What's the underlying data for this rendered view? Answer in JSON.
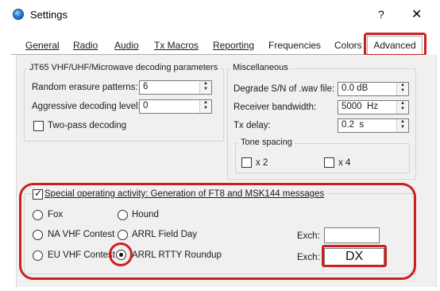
{
  "window": {
    "title": "Settings",
    "help": "?",
    "close": "✕"
  },
  "tabs": [
    {
      "label": "General"
    },
    {
      "label": "Radio"
    },
    {
      "label": "Audio"
    },
    {
      "label": "Tx Macros"
    },
    {
      "label": "Reporting"
    },
    {
      "label": "Frequencies"
    },
    {
      "label": "Colors"
    },
    {
      "label": "Advanced",
      "active": true
    }
  ],
  "jt65": {
    "title": "JT65 VHF/UHF/Microwave decoding parameters",
    "random_erasure_label": "Random erasure patterns:",
    "random_erasure_value": "6",
    "aggressive_label": "Aggressive decoding level:",
    "aggressive_value": "0",
    "two_pass_label": "Two-pass decoding",
    "two_pass_checked": false
  },
  "misc": {
    "title": "Miscellaneous",
    "degrade_label": "Degrade S/N of .wav file:",
    "degrade_value": "0.0 dB",
    "bandwidth_label": "Receiver bandwidth:",
    "bandwidth_value": "5000  Hz",
    "txdelay_label": "Tx delay:",
    "txdelay_value": "0.2  s"
  },
  "tone_spacing": {
    "title": "Tone spacing",
    "x2_label": "x 2",
    "x4_label": "x 4"
  },
  "special": {
    "label": "Special operating activity:  Generation of FT8 and MSK144 messages",
    "checked": true,
    "radios": {
      "fox": "Fox",
      "hound": "Hound",
      "na_vhf": "NA VHF Contest",
      "arrl_fd": "ARRL Field Day",
      "eu_vhf": "EU VHF Contest",
      "arrl_rtty": "ARRL RTTY Roundup"
    },
    "selected": "ARRL RTTY Roundup",
    "exch1_label": "Exch:",
    "exch1_value": "",
    "exch2_label": "Exch:",
    "exch2_value": "DX"
  },
  "colors": {
    "accent_red": "#cc2020",
    "panel_bg": "#f0f0f0"
  }
}
